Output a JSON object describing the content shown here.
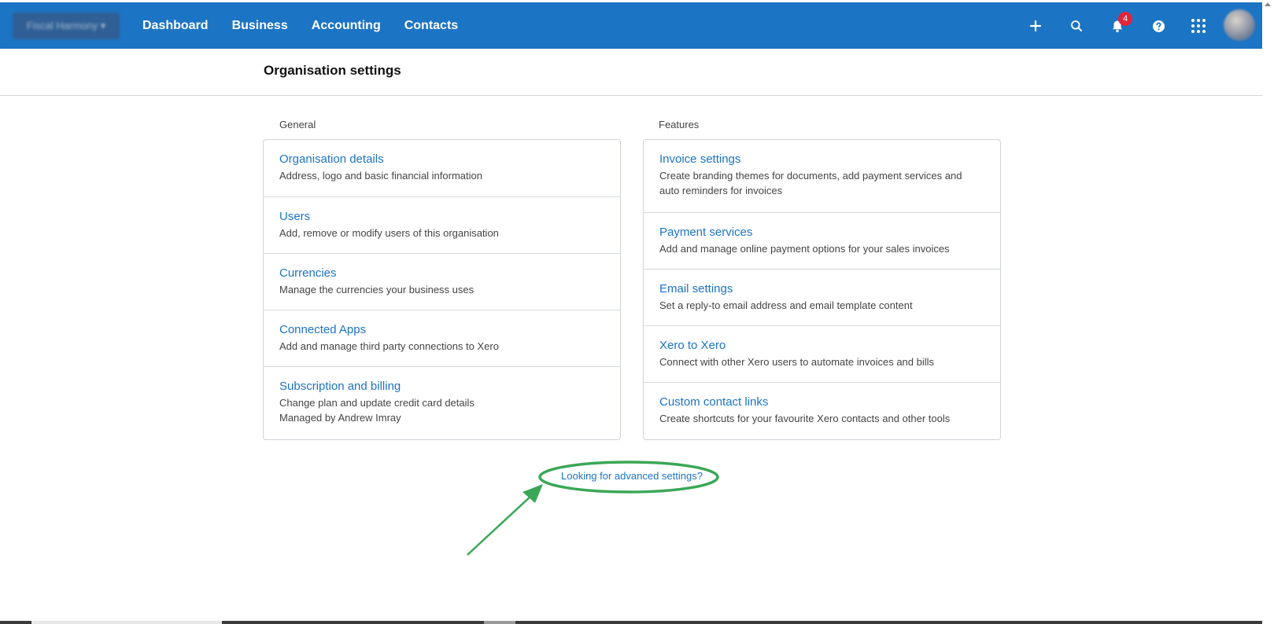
{
  "topbar": {
    "org_name": "Fiscal Harmony",
    "nav": [
      "Dashboard",
      "Business",
      "Accounting",
      "Contacts"
    ],
    "notification_count": "4",
    "icons": [
      "plus-icon",
      "search-icon",
      "bell-icon",
      "help-icon",
      "apps-grid-icon"
    ],
    "background": "#1c74c4"
  },
  "page": {
    "title": "Organisation settings"
  },
  "general": {
    "label": "General",
    "items": [
      {
        "title": "Organisation details",
        "desc": "Address, logo and basic financial information"
      },
      {
        "title": "Users",
        "desc": "Add, remove or modify users of this organisation"
      },
      {
        "title": "Currencies",
        "desc": "Manage the currencies your business uses"
      },
      {
        "title": "Connected Apps",
        "desc": "Add and manage third party connections to Xero"
      },
      {
        "title": "Subscription and billing",
        "desc": "Change plan and update credit card details",
        "desc2": "Managed by Andrew Imray"
      }
    ]
  },
  "features": {
    "label": "Features",
    "items": [
      {
        "title": "Invoice settings",
        "desc": "Create branding themes for documents, add payment services and auto reminders for invoices"
      },
      {
        "title": "Payment services",
        "desc": "Add and manage online payment options for your sales invoices"
      },
      {
        "title": "Email settings",
        "desc": "Set a reply-to email address and email template content"
      },
      {
        "title": "Xero to Xero",
        "desc": "Connect with other Xero users to automate invoices and bills"
      },
      {
        "title": "Custom contact links",
        "desc": "Create shortcuts for your favourite Xero contacts and other tools"
      }
    ]
  },
  "advanced_link": "Looking for advanced settings?",
  "colors": {
    "link": "#1c74c4",
    "annotation": "#3aa757",
    "badge": "#e0243c"
  }
}
